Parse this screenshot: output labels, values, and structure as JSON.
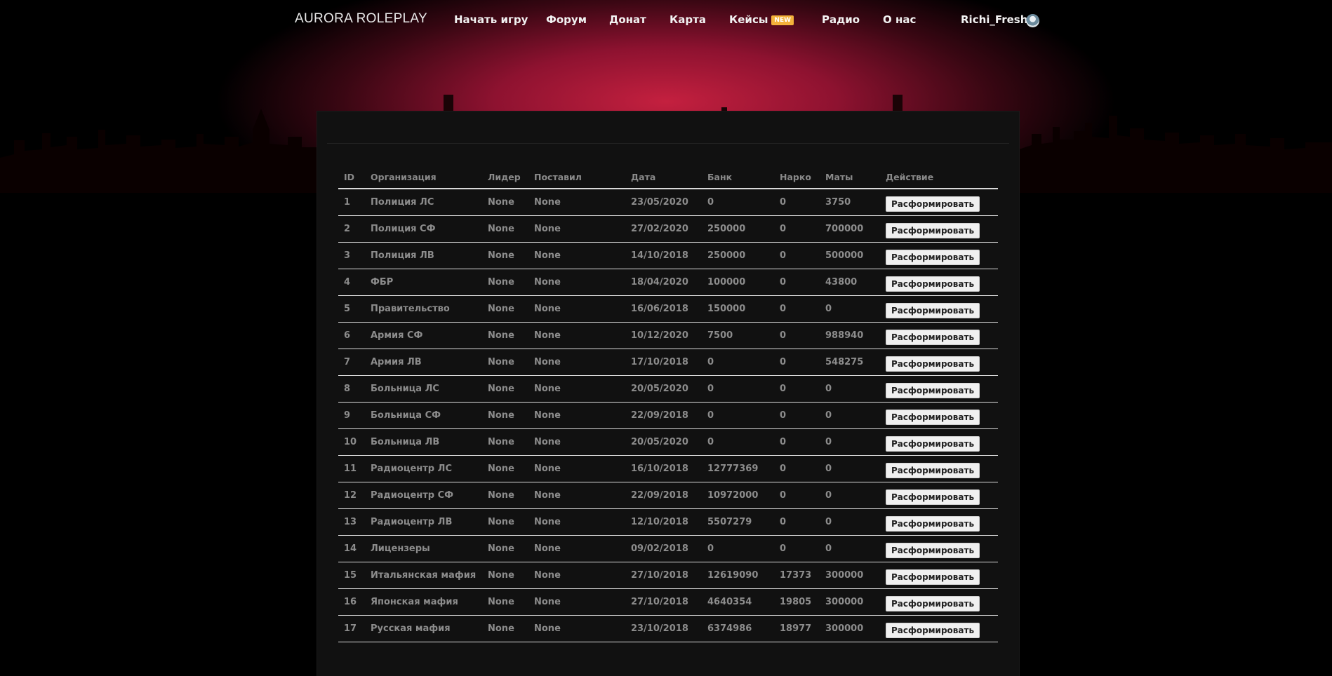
{
  "nav": {
    "logo_main": "AURORA",
    "logo_sub": "ROLEPLAY",
    "items": [
      {
        "label": "Начать игру"
      },
      {
        "label": "Форум"
      },
      {
        "label": "Донат"
      },
      {
        "label": "Карта"
      },
      {
        "label": "Кейсы",
        "badge": "NEW"
      },
      {
        "label": "Радио"
      },
      {
        "label": "О нас"
      }
    ],
    "username": "Richi_Fresh"
  },
  "colors": {
    "accent": "#c4203f",
    "badge": "#f3b23b"
  },
  "table": {
    "headers": [
      "ID",
      "Организация",
      "Лидер",
      "Поставил",
      "Дата",
      "Банк",
      "Нарко",
      "Маты",
      "Действие"
    ],
    "action_label": "Расформировать",
    "rows": [
      [
        "1",
        "Полиция ЛС",
        "None",
        "None",
        "23/05/2020",
        "0",
        "0",
        "3750"
      ],
      [
        "2",
        "Полиция СФ",
        "None",
        "None",
        "27/02/2020",
        "250000",
        "0",
        "700000"
      ],
      [
        "3",
        "Полиция ЛВ",
        "None",
        "None",
        "14/10/2018",
        "250000",
        "0",
        "500000"
      ],
      [
        "4",
        "ФБР",
        "None",
        "None",
        "18/04/2020",
        "100000",
        "0",
        "43800"
      ],
      [
        "5",
        "Правительство",
        "None",
        "None",
        "16/06/2018",
        "150000",
        "0",
        "0"
      ],
      [
        "6",
        "Армия СФ",
        "None",
        "None",
        "10/12/2020",
        "7500",
        "0",
        "988940"
      ],
      [
        "7",
        "Армия ЛВ",
        "None",
        "None",
        "17/10/2018",
        "0",
        "0",
        "548275"
      ],
      [
        "8",
        "Больница ЛС",
        "None",
        "None",
        "20/05/2020",
        "0",
        "0",
        "0"
      ],
      [
        "9",
        "Больница СФ",
        "None",
        "None",
        "22/09/2018",
        "0",
        "0",
        "0"
      ],
      [
        "10",
        "Больница ЛВ",
        "None",
        "None",
        "20/05/2020",
        "0",
        "0",
        "0"
      ],
      [
        "11",
        "Радиоцентр ЛС",
        "None",
        "None",
        "16/10/2018",
        "12777369",
        "0",
        "0"
      ],
      [
        "12",
        "Радиоцентр СФ",
        "None",
        "None",
        "22/09/2018",
        "10972000",
        "0",
        "0"
      ],
      [
        "13",
        "Радиоцентр ЛВ",
        "None",
        "None",
        "12/10/2018",
        "5507279",
        "0",
        "0"
      ],
      [
        "14",
        "Лицензеры",
        "None",
        "None",
        "09/02/2018",
        "0",
        "0",
        "0"
      ],
      [
        "15",
        "Итальянская мафия",
        "None",
        "None",
        "27/10/2018",
        "12619090",
        "17373",
        "300000"
      ],
      [
        "16",
        "Японская мафия",
        "None",
        "None",
        "27/10/2018",
        "4640354",
        "19805",
        "300000"
      ],
      [
        "17",
        "Русская мафия",
        "None",
        "None",
        "23/10/2018",
        "6374986",
        "18977",
        "300000"
      ]
    ]
  }
}
